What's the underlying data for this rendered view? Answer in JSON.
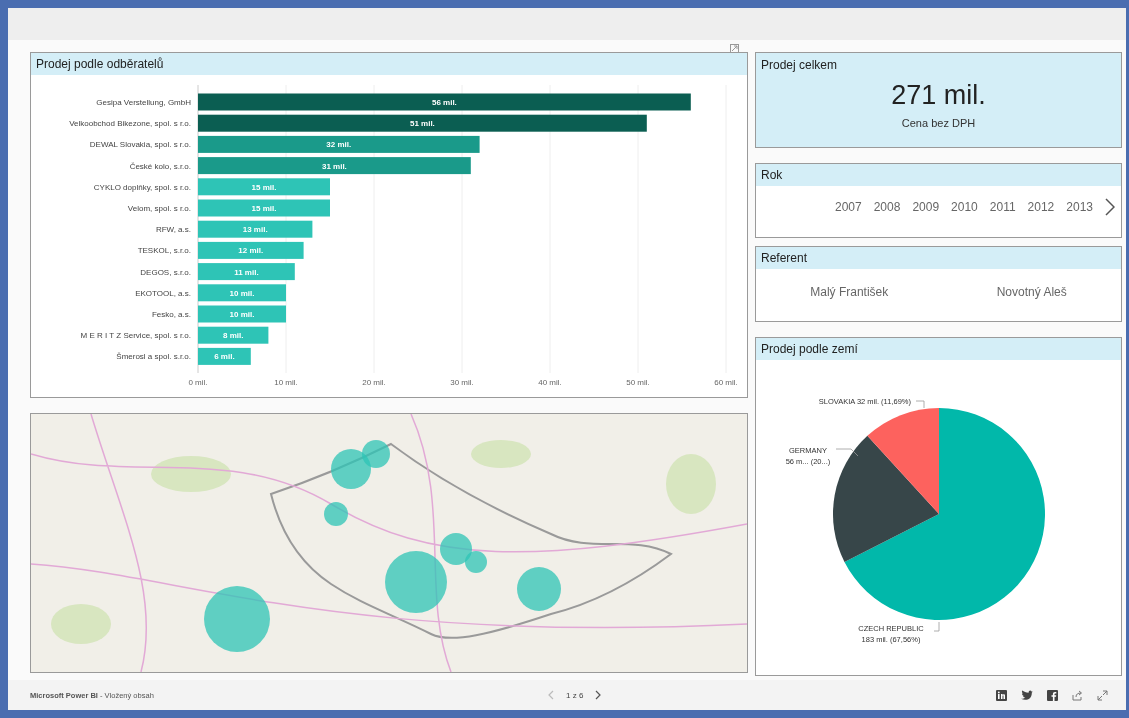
{
  "customers_chart": {
    "title": "Prodej podle odběratelů",
    "chart_data": {
      "type": "bar",
      "orientation": "horizontal",
      "categories": [
        "Gesipa Verstellung, GmbH",
        "Velkoobchod Bikezone, spol. s r.o.",
        "DEWAL Slovakia, spol. s r.o.",
        "České kolo, s.r.o.",
        "CYKLO doplňky, spol. s r.o.",
        "Velom, spol. s r.o.",
        "RFW, a.s.",
        "TESKOL, s.r.o.",
        "DEGOS, s.r.o.",
        "EKOTOOL, a.s.",
        "Fesko, a.s.",
        "M E R I T Z Service, spol. s r.o.",
        "Šmerosl a spol. s.r.o."
      ],
      "values": [
        56,
        51,
        32,
        31,
        15,
        15,
        13,
        12,
        11,
        10,
        10,
        8,
        6
      ],
      "colors": [
        "#0b5e52",
        "#0b5e52",
        "#1a9a8a",
        "#1a9a8a",
        "#2ec4b6",
        "#2ec4b6",
        "#2ec4b6",
        "#2ec4b6",
        "#2ec4b6",
        "#2ec4b6",
        "#2ec4b6",
        "#2ec4b6",
        "#2ec4b6"
      ],
      "grid": true,
      "value_labels": [
        "56 mil.",
        "51 mil.",
        "32 mil.",
        "31 mil.",
        "15 mil.",
        "15 mil.",
        "13 mil.",
        "12 mil.",
        "11 mil.",
        "10 mil.",
        "10 mil.",
        "8 mil.",
        "6 mil."
      ],
      "xlim": [
        0,
        60
      ],
      "xticks": [
        {
          "value": 0,
          "label": "0 mil."
        },
        {
          "value": 10,
          "label": "10 mil."
        },
        {
          "value": 20,
          "label": "20 mil."
        },
        {
          "value": 30,
          "label": "30 mil."
        },
        {
          "value": 40,
          "label": "40 mil."
        },
        {
          "value": 50,
          "label": "50 mil."
        },
        {
          "value": 60,
          "label": "60 mil."
        }
      ]
    }
  },
  "total_card": {
    "title": "Prodej celkem",
    "value": "271 mil.",
    "caption": "Cena bez DPH"
  },
  "year_slicer": {
    "title": "Rok",
    "years": [
      "2007",
      "2008",
      "2009",
      "2010",
      "2011",
      "2012",
      "2013"
    ]
  },
  "person_slicer": {
    "title": "Referent",
    "people": [
      "Malý František",
      "Novotný Aleš"
    ]
  },
  "country_chart": {
    "title": "Prodej podle zemí",
    "chart_data": {
      "type": "pie",
      "categories": [
        "CZECH REPUBLIC",
        "GERMANY",
        "SLOVAKIA"
      ],
      "values": [
        183,
        56,
        32
      ],
      "colors": [
        "#01b8aa",
        "#374649",
        "#fd625e"
      ],
      "value_labels": [
        "183 mil. (67,56%)",
        "56 m... (20...)",
        "32 mil. (11,69%)"
      ]
    }
  },
  "footer": {
    "brand": "**Microsoft Power BI** - Vložený obsah",
    "page": "1 z 6"
  }
}
